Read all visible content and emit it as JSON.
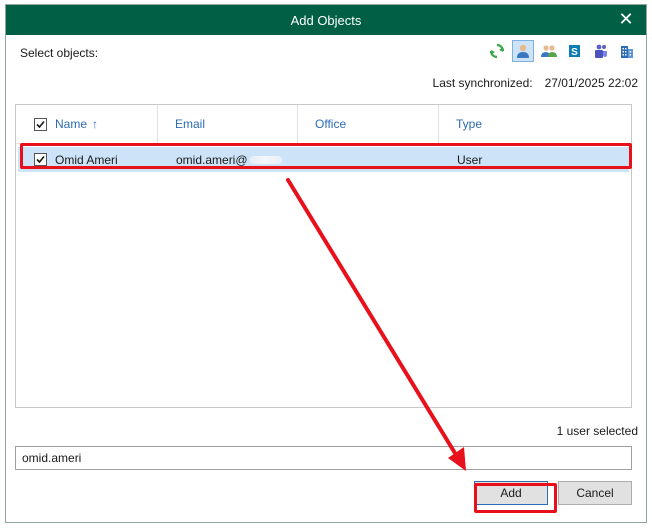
{
  "window": {
    "title": "Add Objects"
  },
  "header": {
    "select_label": "Select objects:",
    "toolbar_icons": [
      "refresh-icon",
      "user-icon",
      "group-icon",
      "sharepoint-icon",
      "teams-icon",
      "organization-icon"
    ],
    "sync_label": "Last synchronized:",
    "sync_value": "27/01/2025 22:02"
  },
  "table": {
    "columns": [
      "Name",
      "Email",
      "Office",
      "Type"
    ],
    "sort_indicator": "↑",
    "rows": [
      {
        "name": "Omid Ameri",
        "email": "omid.ameri@",
        "office": "",
        "type": "User",
        "checked": true
      }
    ]
  },
  "status": {
    "count_text": "1 user selected"
  },
  "search": {
    "value": "omid.ameri"
  },
  "buttons": {
    "add": "Add",
    "cancel": "Cancel"
  },
  "colors": {
    "titlebar": "#005f45",
    "accent": "#2c6bb5",
    "selection": "#cde3f7",
    "annotation": "#e8111b"
  }
}
